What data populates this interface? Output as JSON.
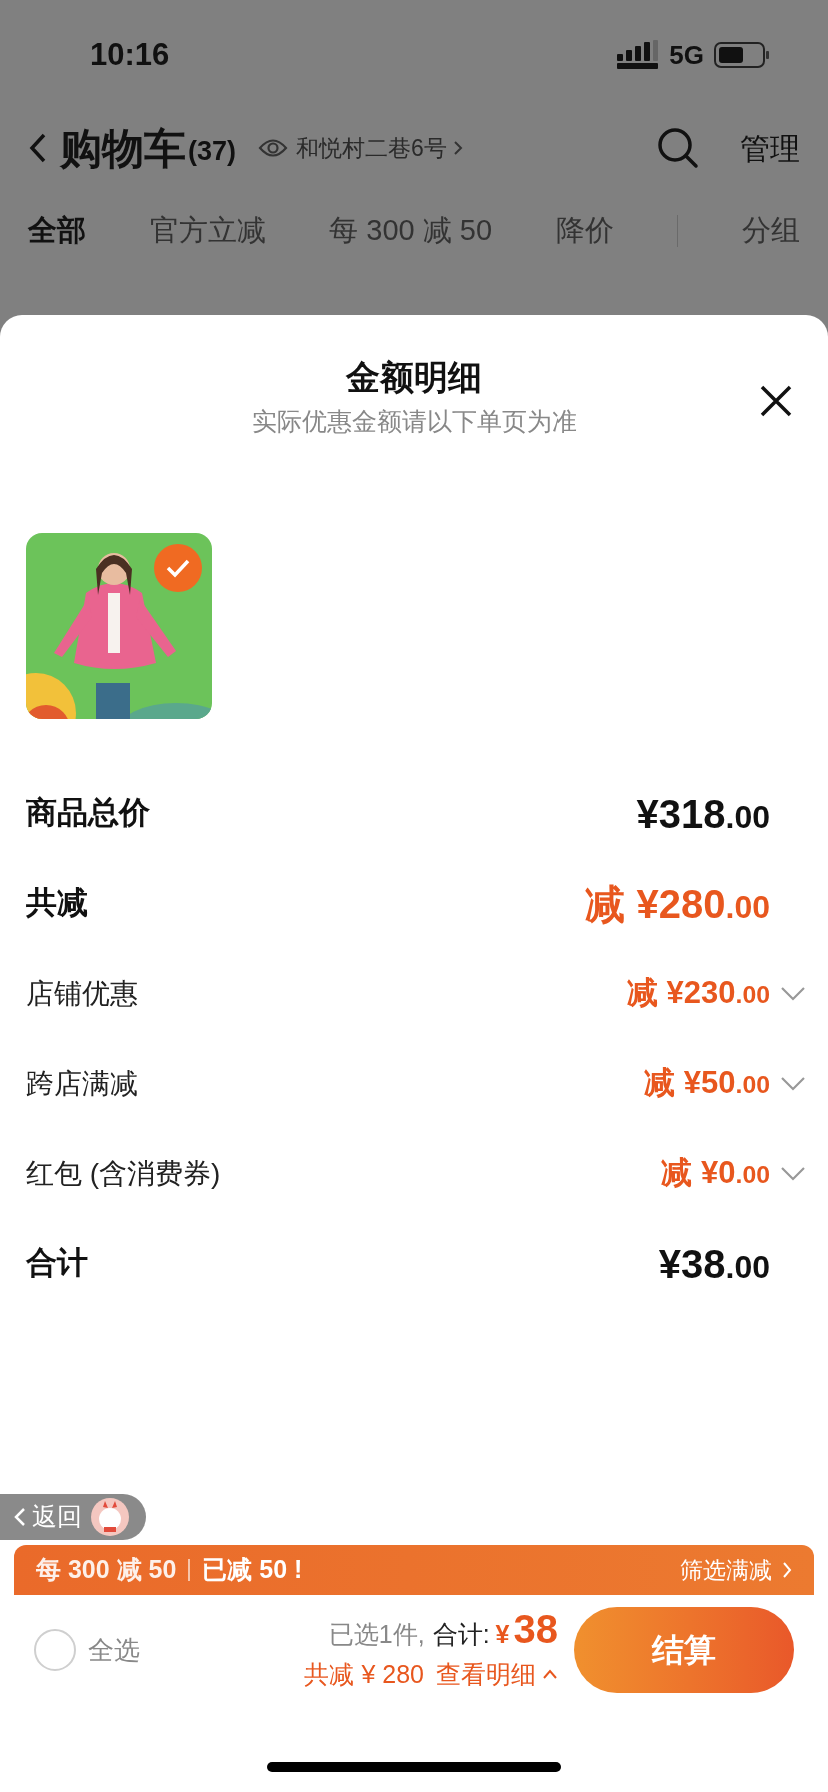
{
  "status_bar": {
    "time": "10:16",
    "network": "5G"
  },
  "header": {
    "title": "购物车",
    "count": "(37)",
    "address": "和悦村二巷6号",
    "action": "管理"
  },
  "tabs": [
    {
      "label": "全部",
      "selected": true
    },
    {
      "label": "官方立减",
      "selected": false
    },
    {
      "label": "每 300 减 50",
      "selected": false
    },
    {
      "label": "降价",
      "selected": false
    },
    {
      "label": "分组",
      "selected": false
    }
  ],
  "sheet": {
    "title": "金额明细",
    "subtitle": "实际优惠金额请以下单页为准",
    "items": [
      {
        "kind": "picture",
        "selected": true
      }
    ],
    "rows": [
      {
        "kind": "main",
        "label": "商品总价",
        "amount": "¥318.00"
      },
      {
        "kind": "discount",
        "label": "共减",
        "amount": "减 ¥280.00"
      },
      {
        "kind": "detail",
        "label": "店铺优惠",
        "amount": "减 ¥230.00",
        "expanded": false
      },
      {
        "kind": "detail",
        "label": "跨店满减",
        "amount": "减 ¥50.00",
        "expanded": false
      },
      {
        "kind": "detail",
        "label": "红包 (含消费券)",
        "amount": "减 ¥0.00",
        "expanded": false
      },
      {
        "kind": "main",
        "label": "合计",
        "amount": "¥38.00"
      }
    ]
  },
  "back_button": {
    "label": "返回"
  },
  "promo_banner": {
    "offer": "每 300 减 50",
    "saved": "已减 50 !",
    "action": "筛选满减"
  },
  "bottom_bar": {
    "select_all": {
      "label": "全选",
      "checked": false
    },
    "selected_count": "已选1件,",
    "total_label": "合计:",
    "currency": "¥",
    "total": "38",
    "discount": "共减 ¥ 280",
    "details_link": "查看明细",
    "details_expanded": true,
    "checkout": "结算"
  }
}
